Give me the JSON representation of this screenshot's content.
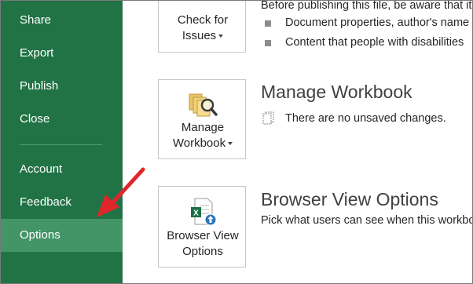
{
  "sidebar": {
    "items": [
      {
        "label": "Share"
      },
      {
        "label": "Export"
      },
      {
        "label": "Publish"
      },
      {
        "label": "Close"
      },
      {
        "label": "Account"
      },
      {
        "label": "Feedback"
      },
      {
        "label": "Options",
        "selected": true
      }
    ]
  },
  "inspect": {
    "button_line1": "Check for",
    "button_line2": "Issues",
    "description": "Before publishing this file, be aware that it contains:",
    "bullets": [
      "Document properties, author's name",
      "Content that people with disabilities"
    ]
  },
  "manage": {
    "button_line1": "Manage",
    "button_line2": "Workbook",
    "title": "Manage Workbook",
    "status": "There are no unsaved changes."
  },
  "browser": {
    "button_line1": "Browser View",
    "button_line2": "Options",
    "title": "Browser View Options",
    "description": "Pick what users can see when this workbook"
  },
  "colors": {
    "sidebar_bg": "#217346",
    "sidebar_selected": "#439467",
    "annotation_arrow": "#e0262b"
  },
  "icons": {
    "manage_workbook": "folder-search-icon",
    "browser_view": "excel-upload-icon",
    "unsaved": "document-icon"
  }
}
